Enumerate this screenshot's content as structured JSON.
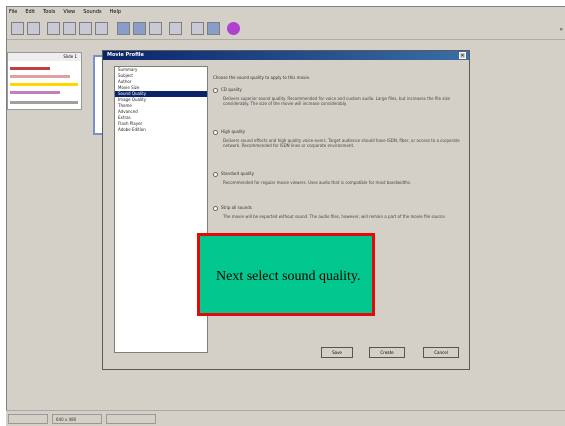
{
  "app": {
    "menu": [
      "File",
      "Edit",
      "Tools",
      "View",
      "Sounds",
      "Help"
    ],
    "slide_pane": {
      "header": "Slide 1"
    }
  },
  "dialog": {
    "title": "Movie Profile",
    "nav_items": [
      "Summary",
      "Subject",
      "Author",
      "Movie Size",
      "Sound Quality",
      "Image Quality",
      "Theme",
      "Advanced",
      "Extras",
      "Flash Player",
      "Adobe Edition"
    ],
    "selected_index": 4,
    "instruction": "Choose the sound quality to apply to this movie.",
    "options": [
      {
        "label": "CD quality",
        "desc": "Delivers superior sound quality. Recommended for voice and custom audio. Large files, but increases the file size considerably. The size of the movie will increase considerably."
      },
      {
        "label": "High quality",
        "desc": "Delivers sound effects and high quality voice-overs. Target audience should have ISDN, fiber, or access to a corporate network. Recommended for ISDN lines or corporate environment."
      },
      {
        "label": "Standard quality",
        "desc": "Recommended for regular movie viewers. Uses audio that is compatible for most bandwidths."
      },
      {
        "label": "Strip all sounds",
        "desc": "The movie will be exported without sound. The audio files, however, will remain a part of the movie file source."
      }
    ],
    "buttons": {
      "save": "Save",
      "create": "Create",
      "cancel": "Cancel"
    }
  },
  "callout": {
    "text": "Next select sound quality."
  },
  "status": {
    "resolution": "640 x 480"
  },
  "colors": {
    "callout_fill": "#02c88f",
    "callout_border": "#e50a0a",
    "title_bar": "#0a246a"
  }
}
